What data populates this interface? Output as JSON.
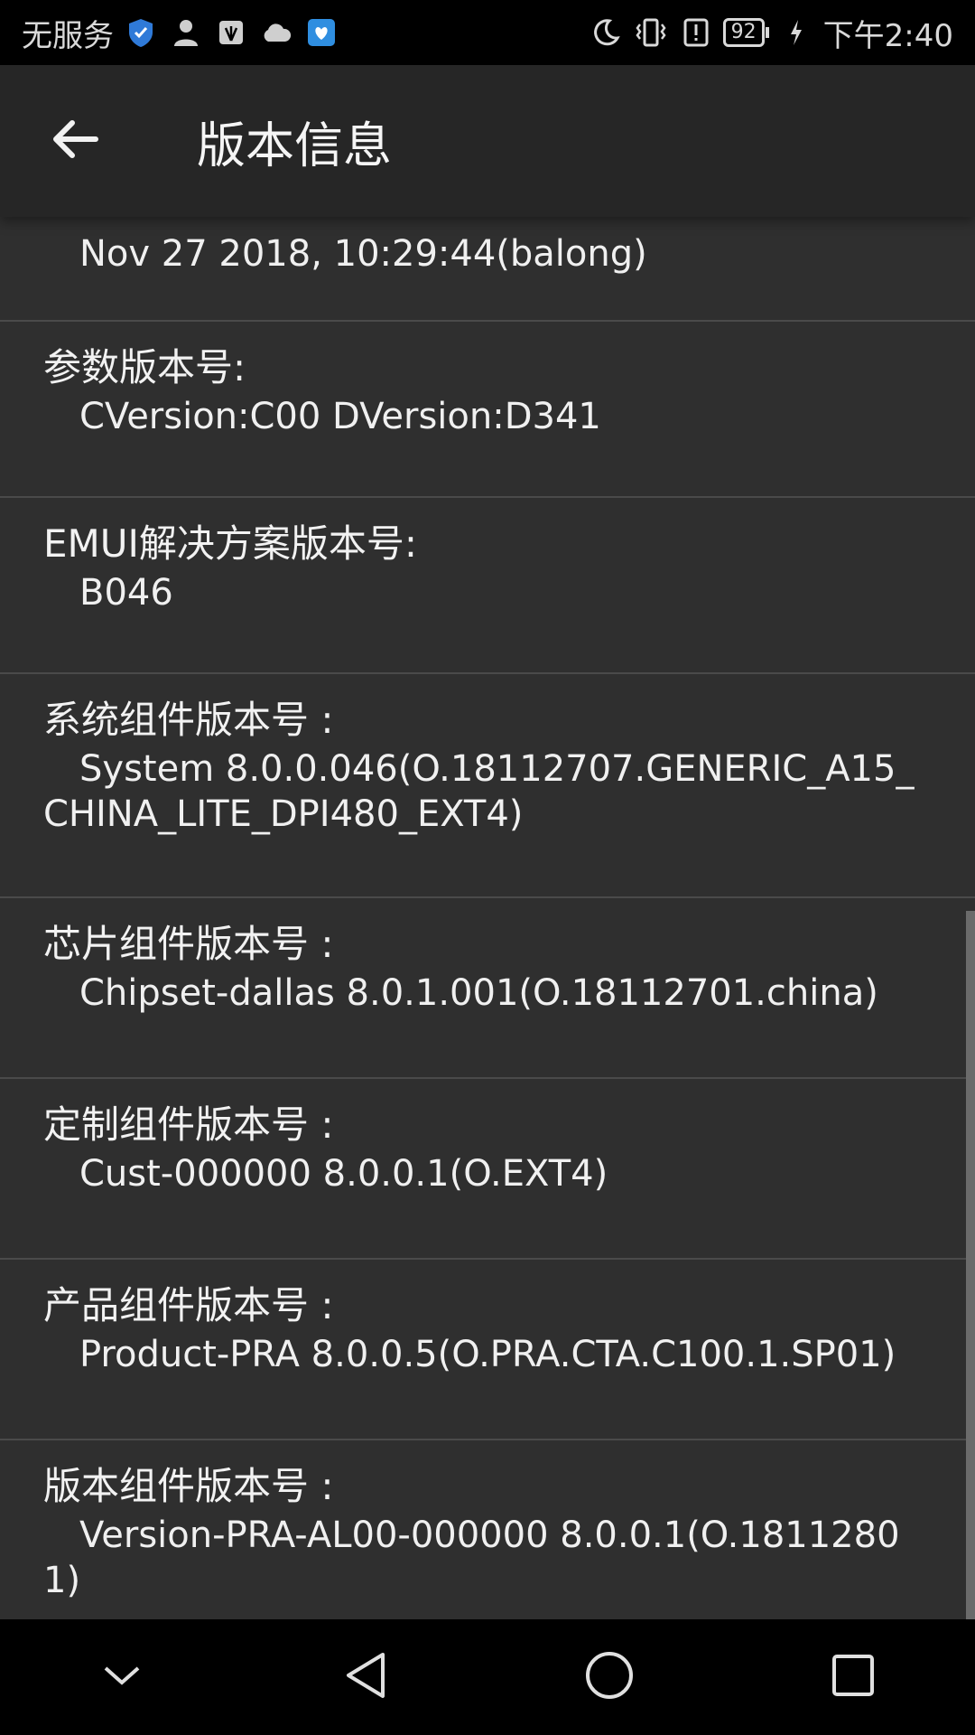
{
  "status_bar": {
    "carrier": "无服务",
    "battery": "92",
    "time": "下午2:40",
    "icons_left": [
      "shield-icon",
      "person-icon",
      "huawei-icon",
      "cloud-icon",
      "heart-book-icon"
    ],
    "icons_right": [
      "moon-icon",
      "vibrate-icon",
      "alert-icon",
      "charging-icon"
    ]
  },
  "app_bar": {
    "title": "版本信息",
    "back_icon": "arrow-left-icon"
  },
  "partial_top": {
    "value": "Nov 27 2018, 10:29:44(balong)"
  },
  "items": [
    {
      "label": "参数版本号:",
      "value": "CVersion:C00 DVersion:D341"
    },
    {
      "label": "EMUI解决方案版本号:",
      "value": "B046"
    },
    {
      "label": "系统组件版本号 :",
      "value": "System 8.0.0.046(O.18112707.GENERIC_A15_CHINA_LITE_DPI480_EXT4)"
    },
    {
      "label": "芯片组件版本号 :",
      "value": "Chipset-dallas 8.0.1.001(O.18112701.china)"
    },
    {
      "label": "定制组件版本号 :",
      "value": "Cust-000000 8.0.0.1(O.EXT4)"
    },
    {
      "label": "产品组件版本号 :",
      "value": "Product-PRA 8.0.0.5(O.PRA.CTA.C100.1.SP01)"
    },
    {
      "label": "版本组件版本号 :",
      "value": "Version-PRA-AL00-000000 8.0.0.1(O.18112801)"
    }
  ],
  "nav_bar": {
    "buttons": [
      "chevron-down-icon",
      "back-triangle-icon",
      "home-circle-icon",
      "recents-square-icon"
    ]
  },
  "colors": {
    "background": "#2f2f2f",
    "app_bar": "#262626",
    "divider": "#4a4a4a",
    "text": "#f2f2f2"
  }
}
